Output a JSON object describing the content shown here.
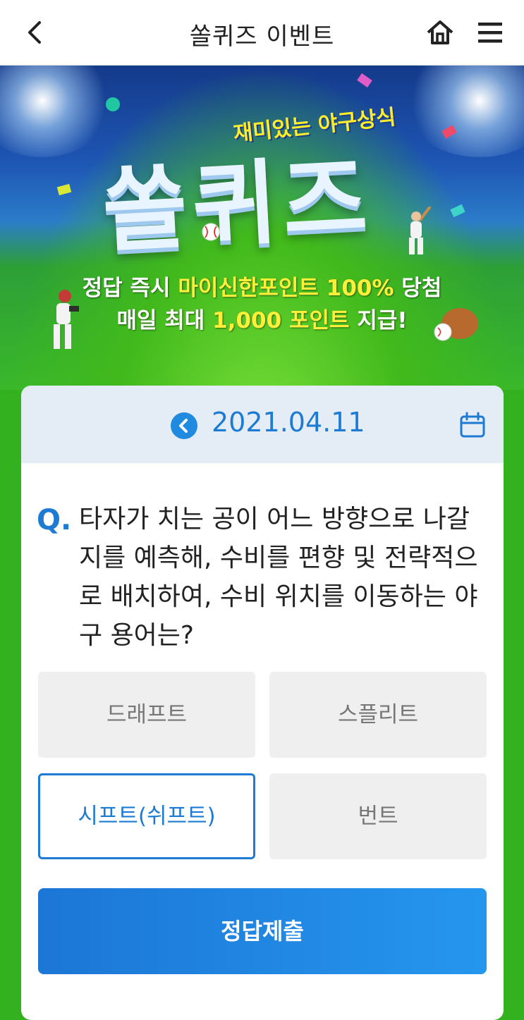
{
  "header": {
    "title": "쏠퀴즈 이벤트",
    "back_icon": "chevron-left-icon",
    "home_icon": "home-icon",
    "menu_icon": "hamburger-menu-icon"
  },
  "banner": {
    "tagline": "재미있는 야구상식",
    "logo": "쏠퀴즈",
    "line1_prefix": "정답 즉시 ",
    "line1_highlight": "마이신한포인트 100%",
    "line1_suffix": " 당첨",
    "line2_prefix": "매일 최대 ",
    "line2_highlight": "1,000 포인트",
    "line2_suffix": " 지급!"
  },
  "quiz": {
    "date": "2021.04.11",
    "q_marker": "Q.",
    "question": "타자가 치는 공이 어느 방향으로 나갈 지를 예측해, 수비를 편향 및 전략적으로 배치하여, 수비 위치를 이동하는 야구 용어는?",
    "options": [
      {
        "label": "드래프트",
        "selected": false
      },
      {
        "label": "스플리트",
        "selected": false
      },
      {
        "label": "시프트(쉬프트)",
        "selected": true
      },
      {
        "label": "번트",
        "selected": false
      }
    ],
    "submit_label": "정답제출"
  },
  "colors": {
    "accent": "#1e7bd4",
    "highlight": "#ffef3a",
    "background": "#33b11f"
  }
}
